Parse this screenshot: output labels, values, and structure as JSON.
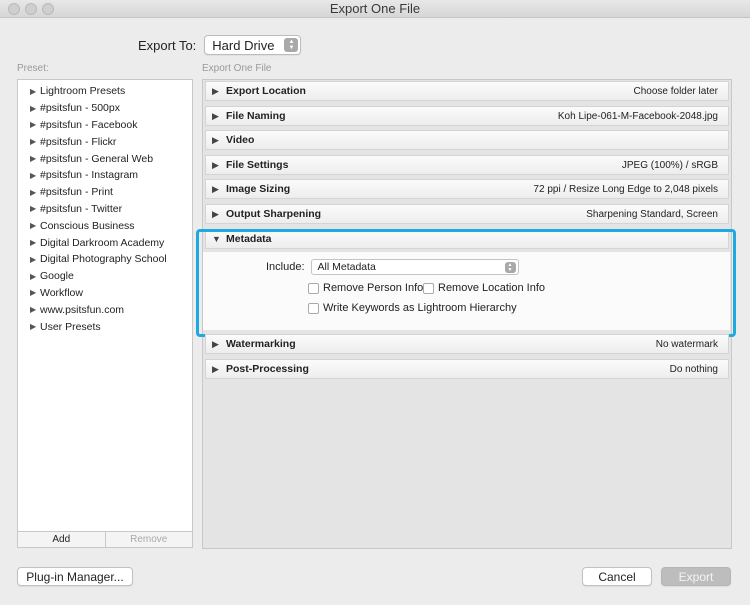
{
  "window": {
    "title": "Export One File"
  },
  "export_to": {
    "label": "Export To:",
    "value": "Hard Drive"
  },
  "preset": {
    "header": "Preset:",
    "items": [
      "Lightroom Presets",
      "#psitsfun - 500px",
      "#psitsfun - Facebook",
      "#psitsfun - Flickr",
      "#psitsfun - General Web",
      "#psitsfun - Instagram",
      "#psitsfun - Print",
      "#psitsfun - Twitter",
      "Conscious Business",
      "Digital Darkroom Academy",
      "Digital Photography School",
      "Google",
      "Workflow",
      "www.psitsfun.com",
      "User Presets"
    ],
    "add_label": "Add",
    "remove_label": "Remove"
  },
  "main": {
    "header": "Export One File",
    "sections": [
      {
        "name": "Export Location",
        "summary": "Choose folder later",
        "icon": "triangle-right-icon"
      },
      {
        "name": "File Naming",
        "summary": "Koh Lipe-061-M-Facebook-2048.jpg",
        "icon": "triangle-right-icon"
      },
      {
        "name": "Video",
        "summary": "",
        "icon": "triangle-right-icon"
      },
      {
        "name": "File Settings",
        "summary": "JPEG (100%) / sRGB",
        "icon": "triangle-right-icon"
      },
      {
        "name": "Image Sizing",
        "summary": "72 ppi / Resize Long Edge to 2,048 pixels",
        "icon": "triangle-right-icon"
      },
      {
        "name": "Output Sharpening",
        "summary": "Sharpening Standard, Screen",
        "icon": "triangle-right-icon"
      },
      {
        "name": "Metadata",
        "summary": "",
        "icon": "triangle-down-icon"
      },
      {
        "name": "Watermarking",
        "summary": "No watermark",
        "icon": "triangle-right-icon"
      },
      {
        "name": "Post-Processing",
        "summary": "Do nothing",
        "icon": "triangle-right-icon"
      }
    ],
    "metadata": {
      "include_label": "Include:",
      "include_value": "All Metadata",
      "remove_person_info": "Remove Person Info",
      "remove_location_info": "Remove Location Info",
      "write_keywords": "Write Keywords as Lightroom Hierarchy"
    }
  },
  "footer": {
    "plugin_manager": "Plug-in Manager...",
    "cancel": "Cancel",
    "export": "Export"
  },
  "colors": {
    "highlight": "#1ea9e1",
    "disabled_button": "#bdbdbd"
  }
}
